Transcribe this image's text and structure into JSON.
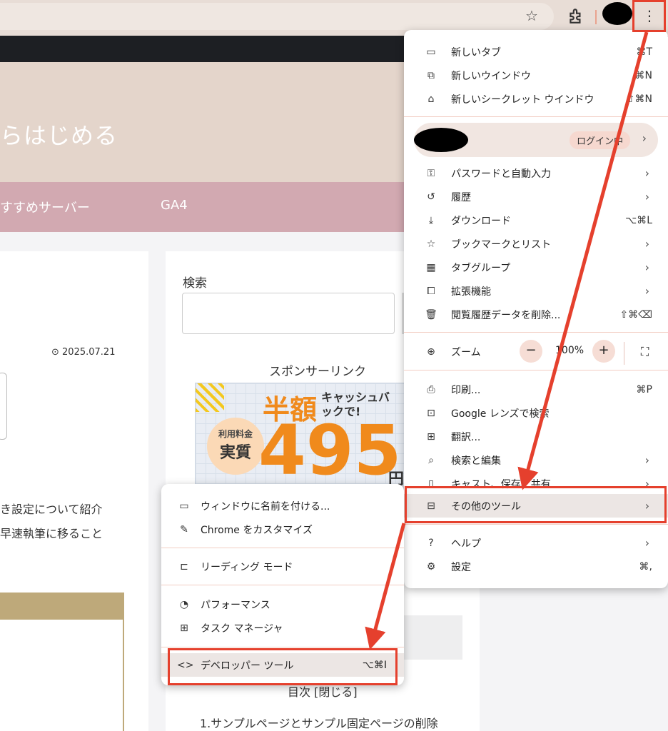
{
  "toolbar": {
    "kebab_icon": "⋮"
  },
  "page": {
    "hero_title": "らはじめる",
    "nav": [
      "すすめサーバー",
      "GA4"
    ],
    "date": "2025.07.21",
    "body_lines": [
      "き設定について紹介",
      "早速執筆に移ること"
    ],
    "search_label": "検索",
    "sponsor_label": "スポンサーリンク",
    "banner": {
      "half": "半額",
      "cashback": "キャッシュバックで!",
      "small": "利用料金",
      "big_label": "実質",
      "price": "495",
      "yen": "円"
    },
    "toc_title": "目次 [閉じる]",
    "toc_item": "1.サンプルページとサンプル固定ページの削除"
  },
  "menu": {
    "items": [
      {
        "label": "新しいタブ",
        "shortcut": "⌘T",
        "icon": "new-tab-icon"
      },
      {
        "label": "新しいウインドウ",
        "shortcut": "⌘N",
        "icon": "new-window-icon"
      },
      {
        "label": "新しいシークレット ウインドウ",
        "shortcut": "⇧⌘N",
        "icon": "incognito-icon"
      }
    ],
    "profile_status": "ログイン中",
    "items2": [
      {
        "label": "パスワードと自動入力",
        "arrow": "›"
      },
      {
        "label": "履歴",
        "arrow": "›"
      },
      {
        "label": "ダウンロード",
        "shortcut": "⌥⌘L"
      },
      {
        "label": "ブックマークとリスト",
        "arrow": "›"
      },
      {
        "label": "タブグループ",
        "arrow": "›"
      },
      {
        "label": "拡張機能",
        "arrow": "›"
      },
      {
        "label": "閲覧履歴データを削除...",
        "shortcut": "⇧⌘⌫"
      }
    ],
    "zoom": {
      "label": "ズーム",
      "value": "100%",
      "minus": "−",
      "plus": "+"
    },
    "items3": [
      {
        "label": "印刷...",
        "shortcut": "⌘P"
      },
      {
        "label": "Google レンズで検索"
      },
      {
        "label": "翻訳..."
      },
      {
        "label": "検索と編集",
        "arrow": "›"
      },
      {
        "label": "キャスト、保存、共有",
        "arrow": "›"
      },
      {
        "label": "その他のツール",
        "arrow": "›"
      }
    ],
    "items4": [
      {
        "label": "ヘルプ",
        "arrow": "›"
      },
      {
        "label": "設定",
        "shortcut": "⌘,"
      }
    ]
  },
  "submenu": {
    "items": [
      {
        "label": "ウィンドウに名前を付ける..."
      },
      {
        "label": "Chrome をカスタマイズ"
      },
      {
        "label": "リーディング モード"
      },
      {
        "label": "パフォーマンス"
      },
      {
        "label": "タスク マネージャ"
      },
      {
        "label": "デベロッパー ツール",
        "shortcut": "⌥⌘I"
      }
    ]
  },
  "colors": {
    "annotation_red": "#e5402d",
    "hero": "#e4d5cb",
    "nav": "#d2a9b1"
  }
}
